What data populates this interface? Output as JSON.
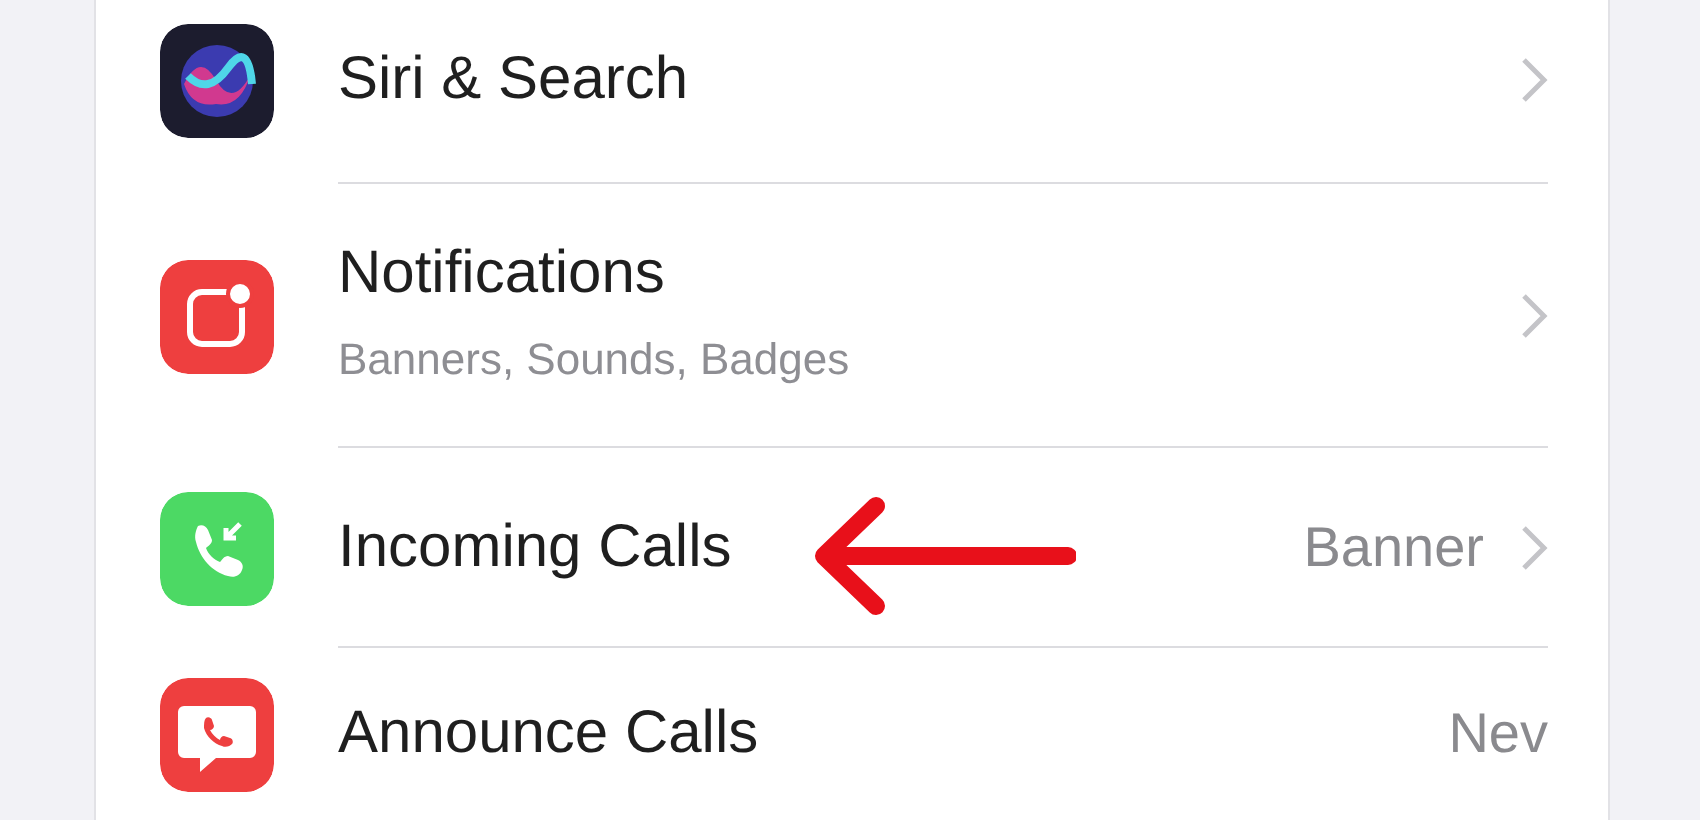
{
  "rows": [
    {
      "title": "Siri & Search",
      "chevron": true,
      "annotated": false
    },
    {
      "title": "Notifications",
      "subtitle": "Banners, Sounds, Badges",
      "chevron": true,
      "annotated": false
    },
    {
      "title": "Incoming Calls",
      "value": "Banner",
      "chevron": true,
      "annotated": true
    },
    {
      "title": "Announce Calls",
      "value": "Nev",
      "chevron": false,
      "annotated": false
    }
  ]
}
